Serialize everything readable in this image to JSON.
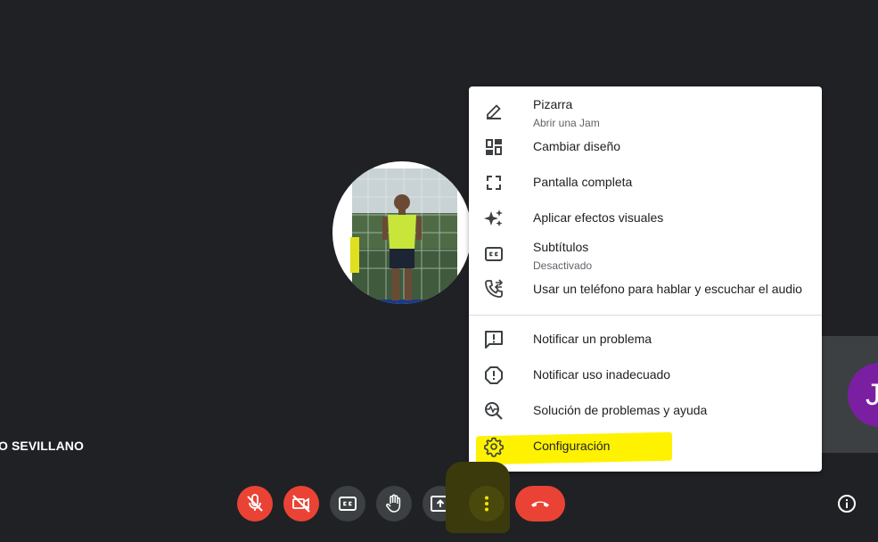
{
  "participant": {
    "name": "O SEVILLANO"
  },
  "side_tile": {
    "initial": "J"
  },
  "menu": {
    "items": [
      {
        "label": "Pizarra",
        "sublabel": "Abrir una Jam",
        "icon": "pencil-icon"
      },
      {
        "label": "Cambiar diseño",
        "icon": "layout-icon"
      },
      {
        "label": "Pantalla completa",
        "icon": "fullscreen-icon"
      },
      {
        "label": "Aplicar efectos visuales",
        "icon": "sparkle-icon"
      },
      {
        "label": "Subtítulos",
        "sublabel": "Desactivado",
        "icon": "captions-icon"
      },
      {
        "label": "Usar un teléfono para hablar y escuchar el audio",
        "icon": "phone-forward-icon"
      },
      {
        "label": "Notificar un problema",
        "icon": "feedback-icon"
      },
      {
        "label": "Notificar uso inadecuado",
        "icon": "report-icon"
      },
      {
        "label": "Solución de problemas y ayuda",
        "icon": "troubleshoot-icon"
      },
      {
        "label": "Configuración",
        "icon": "settings-icon"
      }
    ]
  },
  "controls": {
    "mic": "mic-off-icon",
    "camera": "camera-off-icon",
    "captions": "captions-icon",
    "raise_hand": "hand-icon",
    "present": "present-icon",
    "more": "more-vert-icon",
    "hangup": "call-end-icon",
    "info": "info-icon"
  },
  "colors": {
    "background": "#202124",
    "danger": "#ea4335",
    "control_gray": "#3c4043",
    "highlight": "#fff200",
    "avatar_purple": "#7b1fa2"
  }
}
